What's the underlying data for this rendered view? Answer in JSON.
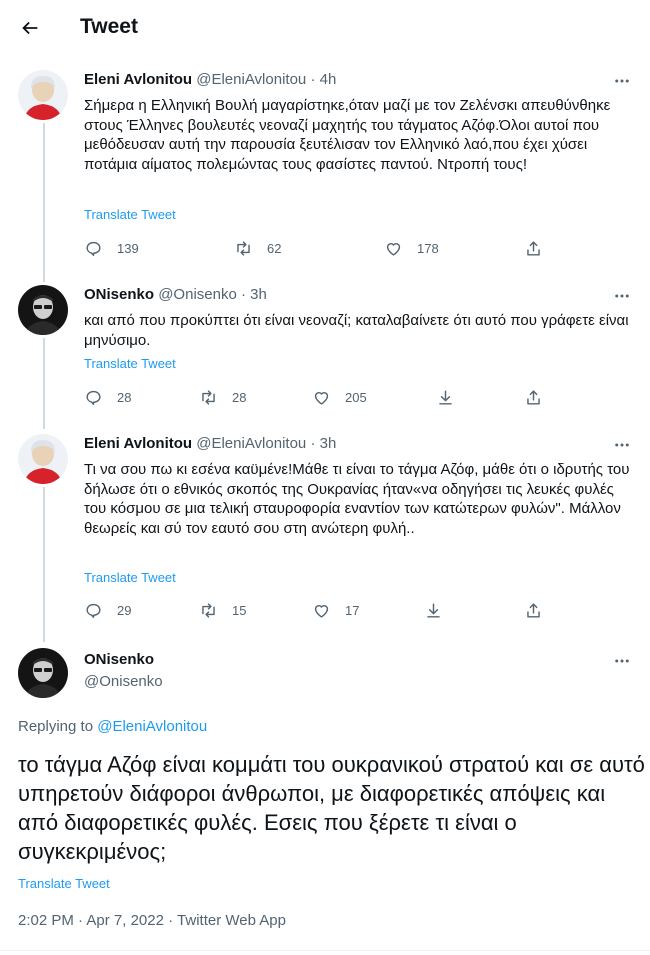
{
  "header": {
    "title": "Tweet"
  },
  "tweets": [
    {
      "name": "Eleni Avlonitou",
      "handle": "@EleniAvlonitou",
      "time": "4h",
      "text": "Σήμερα η Ελληνική Βουλή μαγαρίστηκε,όταν μαζί με τον Ζελένσκι απευθύνθηκε στους Έλληνες βουλευτές νεοναζί μαχητής του τάγματος Αζόφ.Όλοι αυτοί που μεθόδευσαν αυτή την παρουσία ξευτέλισαν τον Ελληνικό λαό,που έχει χύσει ποτάμια αίματος πολεμώντας τους φασίστες παντού. Ντροπή τους!",
      "translate": "Translate Tweet",
      "replies": "139",
      "retweets": "62",
      "likes": "178"
    },
    {
      "name": "ONisenko",
      "handle": "@Onisenko",
      "time": "3h",
      "text": "και από που προκύπτει ότι είναι νεοναζί; καταλαβαίνετε ότι αυτό που γράφετε είναι μηνύσιμο.",
      "translate": "Translate Tweet",
      "replies": "28",
      "retweets": "28",
      "likes": "205"
    },
    {
      "name": "Eleni Avlonitou",
      "handle": "@EleniAvlonitou",
      "time": "3h",
      "text": "Τι να σου πω κι εσένα καϋμένε!Μάθε τι είναι το τάγμα Αζόφ, μάθε ότι ο ιδρυτής του δήλωσε ότι ο εθνικός σκοπός της Ουκρανίας ήταν«να οδηγήσει τις λευκές φυλές του κόσμου σε μια τελική σταυροφορία εναντίον των κατώτερων φυλών\". Μάλλον θεωρείς και σύ τον εαυτό σου στη ανώτερη φυλή..",
      "translate": "Translate Tweet",
      "replies": "29",
      "retweets": "15",
      "likes": "17"
    }
  ],
  "main_tweet": {
    "name": "ONisenko",
    "handle": "@Onisenko",
    "replying_prefix": "Replying to",
    "replying_to": "@EleniAvlonitou",
    "text": "το τάγμα Αζόφ είναι κομμάτι του ουκρανικού στρατού και σε αυτό υπηρετούν διάφοροι άνθρωποι, με διαφορετικές απόψεις και από διαφορετικές φυλές. Εσεις που ξέρετε τι είναι ο συγκεκριμένος;",
    "translate": "Translate Tweet",
    "time": "2:02 PM",
    "date": "Apr 7, 2022",
    "source": "Twitter Web App",
    "separator": "·"
  },
  "colors": {
    "link": "#1d9bf0",
    "secondary": "#536471",
    "primary": "#0f1419",
    "thread_line": "#cfd9de",
    "avatar_red": "#d6232b"
  },
  "icons": [
    "back-arrow-icon",
    "more-icon",
    "reply-icon",
    "retweet-icon",
    "like-icon",
    "share-icon",
    "download-icon"
  ]
}
